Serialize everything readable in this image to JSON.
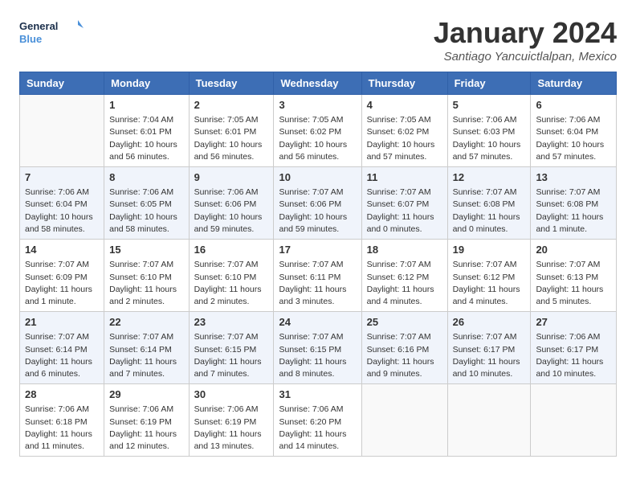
{
  "header": {
    "logo_line1": "General",
    "logo_line2": "Blue",
    "month_title": "January 2024",
    "subtitle": "Santiago Yancuictlalpan, Mexico"
  },
  "weekdays": [
    "Sunday",
    "Monday",
    "Tuesday",
    "Wednesday",
    "Thursday",
    "Friday",
    "Saturday"
  ],
  "weeks": [
    [
      {
        "day": "",
        "info": ""
      },
      {
        "day": "1",
        "info": "Sunrise: 7:04 AM\nSunset: 6:01 PM\nDaylight: 10 hours\nand 56 minutes."
      },
      {
        "day": "2",
        "info": "Sunrise: 7:05 AM\nSunset: 6:01 PM\nDaylight: 10 hours\nand 56 minutes."
      },
      {
        "day": "3",
        "info": "Sunrise: 7:05 AM\nSunset: 6:02 PM\nDaylight: 10 hours\nand 56 minutes."
      },
      {
        "day": "4",
        "info": "Sunrise: 7:05 AM\nSunset: 6:02 PM\nDaylight: 10 hours\nand 57 minutes."
      },
      {
        "day": "5",
        "info": "Sunrise: 7:06 AM\nSunset: 6:03 PM\nDaylight: 10 hours\nand 57 minutes."
      },
      {
        "day": "6",
        "info": "Sunrise: 7:06 AM\nSunset: 6:04 PM\nDaylight: 10 hours\nand 57 minutes."
      }
    ],
    [
      {
        "day": "7",
        "info": "Sunrise: 7:06 AM\nSunset: 6:04 PM\nDaylight: 10 hours\nand 58 minutes."
      },
      {
        "day": "8",
        "info": "Sunrise: 7:06 AM\nSunset: 6:05 PM\nDaylight: 10 hours\nand 58 minutes."
      },
      {
        "day": "9",
        "info": "Sunrise: 7:06 AM\nSunset: 6:06 PM\nDaylight: 10 hours\nand 59 minutes."
      },
      {
        "day": "10",
        "info": "Sunrise: 7:07 AM\nSunset: 6:06 PM\nDaylight: 10 hours\nand 59 minutes."
      },
      {
        "day": "11",
        "info": "Sunrise: 7:07 AM\nSunset: 6:07 PM\nDaylight: 11 hours\nand 0 minutes."
      },
      {
        "day": "12",
        "info": "Sunrise: 7:07 AM\nSunset: 6:08 PM\nDaylight: 11 hours\nand 0 minutes."
      },
      {
        "day": "13",
        "info": "Sunrise: 7:07 AM\nSunset: 6:08 PM\nDaylight: 11 hours\nand 1 minute."
      }
    ],
    [
      {
        "day": "14",
        "info": "Sunrise: 7:07 AM\nSunset: 6:09 PM\nDaylight: 11 hours\nand 1 minute."
      },
      {
        "day": "15",
        "info": "Sunrise: 7:07 AM\nSunset: 6:10 PM\nDaylight: 11 hours\nand 2 minutes."
      },
      {
        "day": "16",
        "info": "Sunrise: 7:07 AM\nSunset: 6:10 PM\nDaylight: 11 hours\nand 2 minutes."
      },
      {
        "day": "17",
        "info": "Sunrise: 7:07 AM\nSunset: 6:11 PM\nDaylight: 11 hours\nand 3 minutes."
      },
      {
        "day": "18",
        "info": "Sunrise: 7:07 AM\nSunset: 6:12 PM\nDaylight: 11 hours\nand 4 minutes."
      },
      {
        "day": "19",
        "info": "Sunrise: 7:07 AM\nSunset: 6:12 PM\nDaylight: 11 hours\nand 4 minutes."
      },
      {
        "day": "20",
        "info": "Sunrise: 7:07 AM\nSunset: 6:13 PM\nDaylight: 11 hours\nand 5 minutes."
      }
    ],
    [
      {
        "day": "21",
        "info": "Sunrise: 7:07 AM\nSunset: 6:14 PM\nDaylight: 11 hours\nand 6 minutes."
      },
      {
        "day": "22",
        "info": "Sunrise: 7:07 AM\nSunset: 6:14 PM\nDaylight: 11 hours\nand 7 minutes."
      },
      {
        "day": "23",
        "info": "Sunrise: 7:07 AM\nSunset: 6:15 PM\nDaylight: 11 hours\nand 7 minutes."
      },
      {
        "day": "24",
        "info": "Sunrise: 7:07 AM\nSunset: 6:15 PM\nDaylight: 11 hours\nand 8 minutes."
      },
      {
        "day": "25",
        "info": "Sunrise: 7:07 AM\nSunset: 6:16 PM\nDaylight: 11 hours\nand 9 minutes."
      },
      {
        "day": "26",
        "info": "Sunrise: 7:07 AM\nSunset: 6:17 PM\nDaylight: 11 hours\nand 10 minutes."
      },
      {
        "day": "27",
        "info": "Sunrise: 7:06 AM\nSunset: 6:17 PM\nDaylight: 11 hours\nand 10 minutes."
      }
    ],
    [
      {
        "day": "28",
        "info": "Sunrise: 7:06 AM\nSunset: 6:18 PM\nDaylight: 11 hours\nand 11 minutes."
      },
      {
        "day": "29",
        "info": "Sunrise: 7:06 AM\nSunset: 6:19 PM\nDaylight: 11 hours\nand 12 minutes."
      },
      {
        "day": "30",
        "info": "Sunrise: 7:06 AM\nSunset: 6:19 PM\nDaylight: 11 hours\nand 13 minutes."
      },
      {
        "day": "31",
        "info": "Sunrise: 7:06 AM\nSunset: 6:20 PM\nDaylight: 11 hours\nand 14 minutes."
      },
      {
        "day": "",
        "info": ""
      },
      {
        "day": "",
        "info": ""
      },
      {
        "day": "",
        "info": ""
      }
    ]
  ]
}
